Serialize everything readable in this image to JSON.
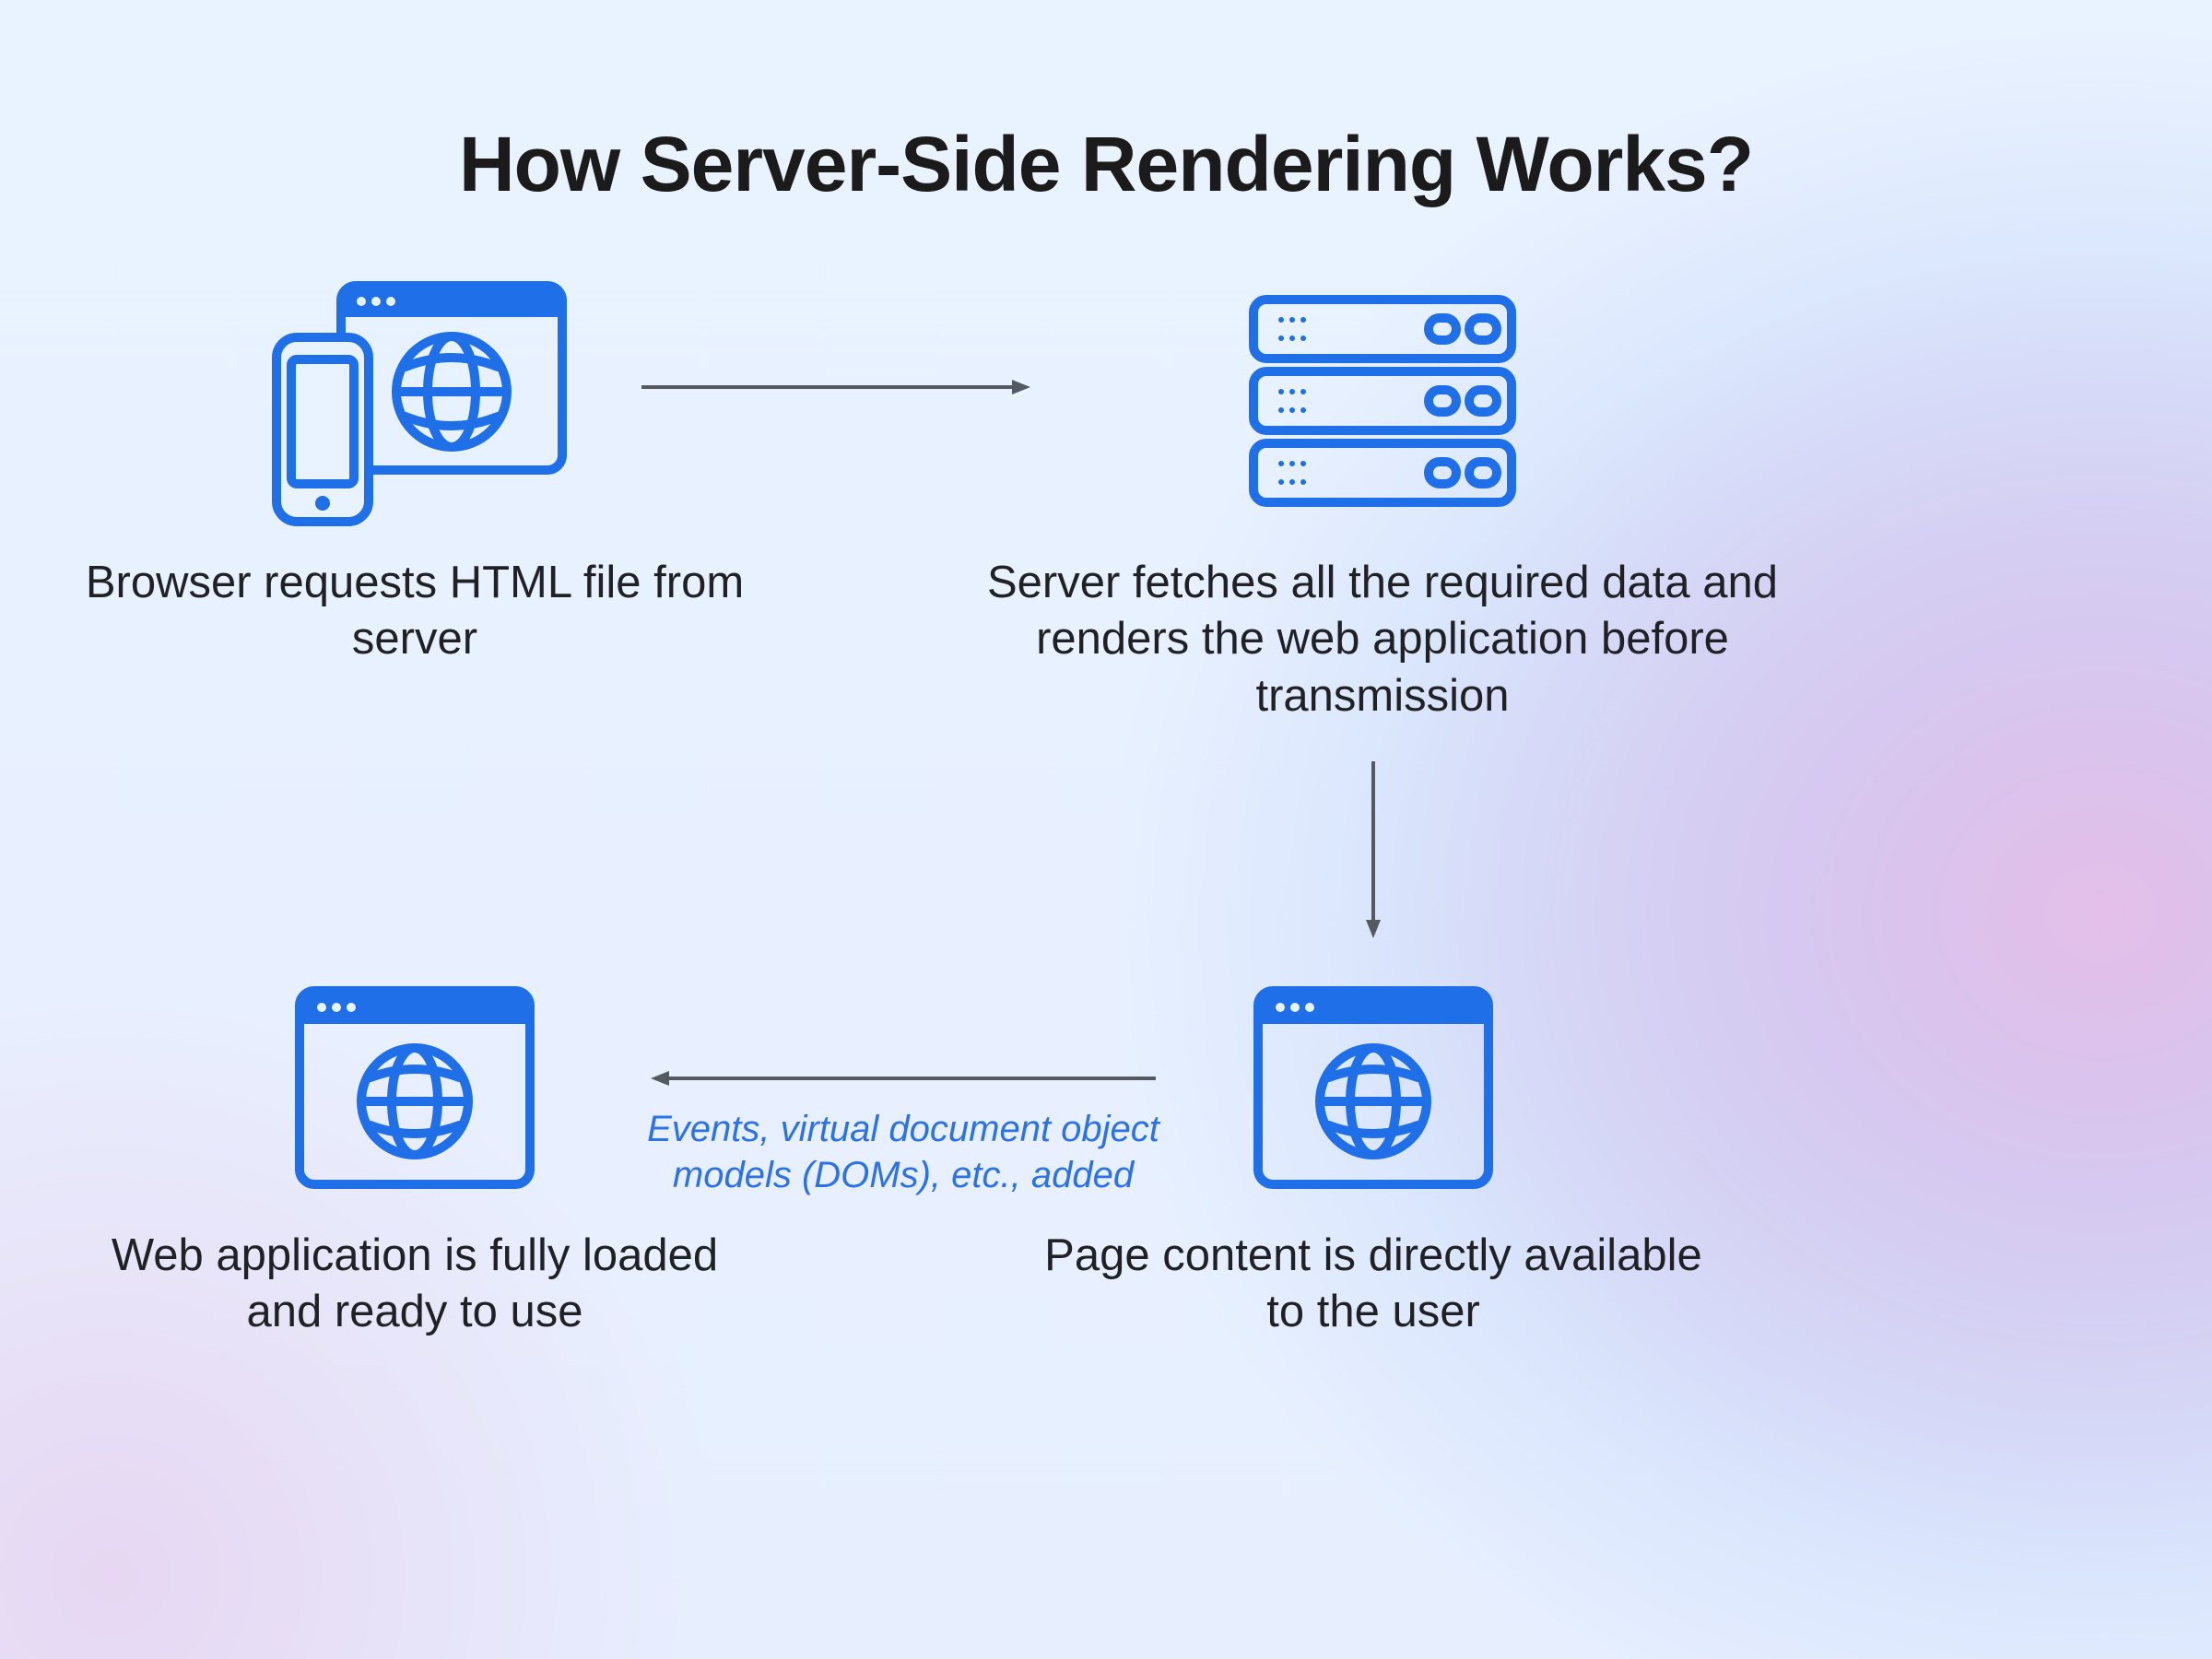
{
  "title": "How Server-Side Rendering Works?",
  "nodes": {
    "step1": {
      "icon": "browser-phone-globe-icon",
      "caption": "Browser requests HTML file from server"
    },
    "step2": {
      "icon": "server-stack-icon",
      "caption": "Server fetches all the required data and renders the web application before transmission"
    },
    "step3": {
      "icon": "browser-globe-icon",
      "caption": "Page content is directly available to the user"
    },
    "step4": {
      "icon": "browser-globe-icon",
      "caption": "Web application is fully loaded and ready to use"
    }
  },
  "edges": {
    "e3_to_e4_label": "Events, virtual document object models (DOMs), etc., added"
  },
  "colors": {
    "icon_stroke": "#1f6fe8",
    "arrow": "#555a60",
    "edge_label": "#2b72e9"
  }
}
